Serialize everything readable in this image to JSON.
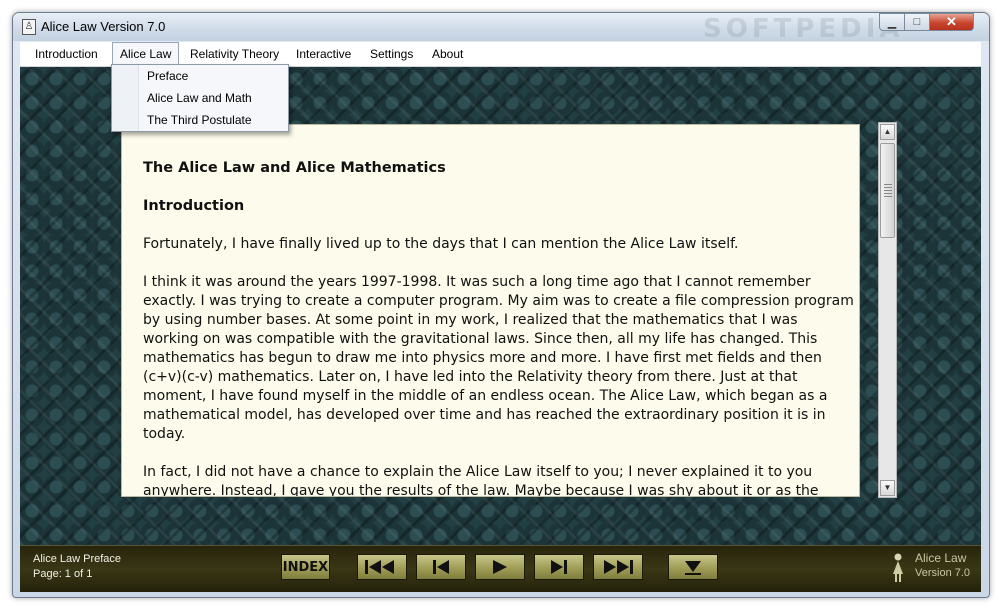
{
  "window": {
    "title": "Alice Law Version 7.0",
    "watermark": "SOFTPEDIA",
    "minimize_glyph": "▁",
    "maximize_glyph": "□",
    "close_glyph": "✕"
  },
  "menu": {
    "items": [
      {
        "label": "Introduction"
      },
      {
        "label": "Alice Law",
        "active": true
      },
      {
        "label": "Relativity Theory"
      },
      {
        "label": "Interactive"
      },
      {
        "label": "Settings"
      },
      {
        "label": "About"
      }
    ]
  },
  "dropdown": {
    "items": [
      {
        "label": "Preface"
      },
      {
        "label": "Alice Law and Math"
      },
      {
        "label": "The Third Postulate"
      }
    ]
  },
  "document": {
    "title": "The Alice Law and Alice Mathematics",
    "section": "Introduction",
    "paragraphs": [
      "Fortunately, I have finally lived up to the days that I can mention the Alice Law itself.",
      "I think it was around the years 1997-1998. It was such a long time ago that I cannot remember exactly. I was trying to create a computer program. My aim was to create a file compression program by using number bases. At some point in my work, I realized that the mathematics that I was working on was compatible with the gravitational laws. Since then, all my life has changed. This mathematics has begun to draw me into physics more and more. I have first met fields and then (c+v)(c-v) mathematics. Later on, I have led into the Relativity theory from there. Just at that moment, I have found myself in the middle of an endless ocean. The Alice Law, which began as a mathematical model, has developed over time and has reached the extraordinary position it is in today.",
      "In fact, I did not have a chance to explain the Alice Law itself to you; I never explained it to you anywhere. Instead, I gave you the results of the law. Maybe because I was shy about it or as the"
    ]
  },
  "footer": {
    "page_name": "Alice Law Preface",
    "page_number": "Page: 1 of 1",
    "index_label": "INDEX",
    "brand_title": "Alice Law",
    "brand_version": "Version 7.0"
  },
  "colors": {
    "menu_active_border": "#9aa7b5",
    "document_background": "#fdfcec",
    "footer_background": "#2f2c12",
    "footer_button": "#a9a760",
    "close_button": "#c8452e"
  }
}
